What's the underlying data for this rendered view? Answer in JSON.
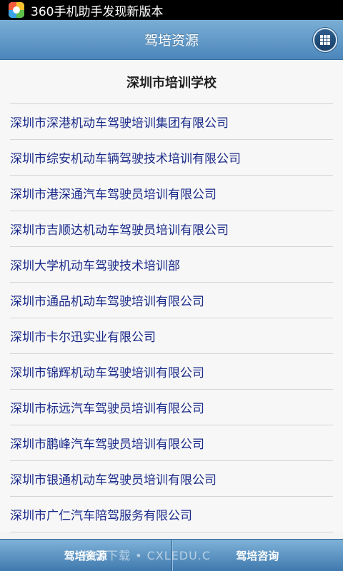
{
  "status_bar": {
    "notification_text": "360手机助手发现新版本"
  },
  "header": {
    "title": "驾培资源"
  },
  "section": {
    "title": "深圳市培训学校"
  },
  "schools": [
    "深圳市深港机动车驾驶培训集团有限公司",
    "深圳市综安机动车辆驾驶技术培训有限公司",
    "深圳市港深通汽车驾驶员培训有限公司",
    "深圳市吉顺达机动车驾驶员培训有限公司",
    "深圳大学机动车驾驶技术培训部",
    "深圳市通品机动车驾驶培训有限公司",
    "深圳市卡尔迅实业有限公司",
    "深圳市锦辉机动车驾驶培训有限公司",
    "深圳市标远汽车驾驶员培训有限公司",
    "深圳市鹏峰汽车驾驶员培训有限公司",
    "深圳市银通机动车驾驶员培训有限公司",
    "深圳市广仁汽车陪驾服务有限公司"
  ],
  "bottom_bar": {
    "left_label": "驾培资源",
    "right_label": "驾培咨询"
  },
  "watermark": "畅乐下载 • CXLEDU.C",
  "colors": {
    "header_top": "#7aaed4",
    "header_bottom": "#4b86bb",
    "link_text": "#1a2a8a"
  }
}
